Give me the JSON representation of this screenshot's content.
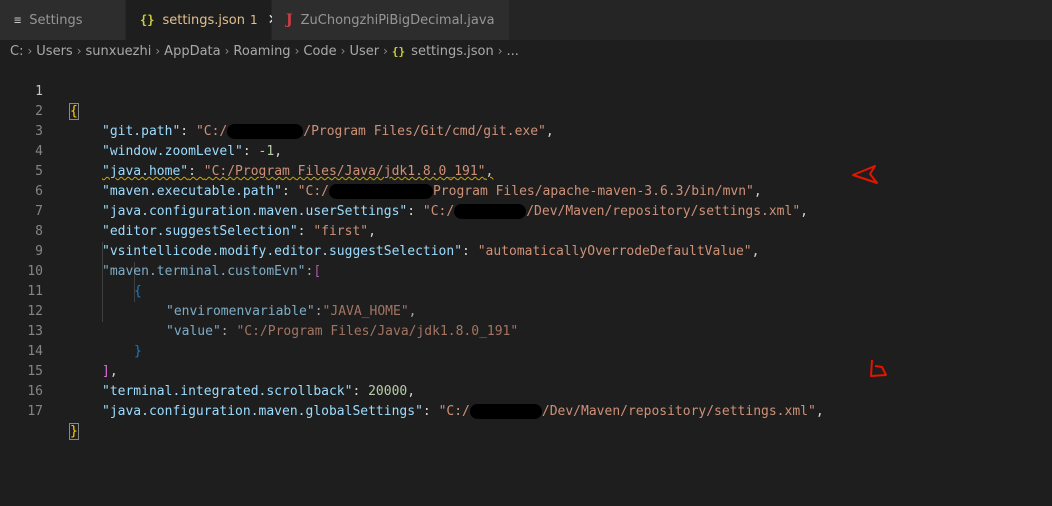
{
  "tabs": [
    {
      "label": "Settings",
      "icon": "menu-icon"
    },
    {
      "label": "settings.json",
      "badge": "1",
      "icon": "json-braces-icon",
      "active": true
    },
    {
      "label": "ZuChongzhiPiBigDecimal.java",
      "icon": "java-file-icon"
    }
  ],
  "breadcrumb": [
    "C:",
    "Users",
    "sunxuezhi",
    "AppData",
    "Roaming",
    "Code",
    "User",
    "settings.json",
    "..."
  ],
  "editor": {
    "line_numbers": [
      "1",
      "2",
      "3",
      "4",
      "5",
      "6",
      "7",
      "8",
      "9",
      "10",
      "11",
      "12",
      "13",
      "14",
      "15",
      "16",
      "17"
    ],
    "lines": {
      "l1_open": "{",
      "l2": {
        "key": "\"git.path\"",
        "colon": ": ",
        "val_a": "\"C:/",
        "val_b": "/Program Files/Git/cmd/git.exe\"",
        "comma": ","
      },
      "l3": {
        "key": "\"window.zoomLevel\"",
        "colon": ": ",
        "val": "-1",
        "comma": ","
      },
      "l4": {
        "key": "\"java.home\"",
        "colon": ": ",
        "val": "\"C:/Program Files/Java/jdk1.8.0_191\"",
        "comma": ","
      },
      "l5": {
        "key": "\"maven.executable.path\"",
        "colon": ": ",
        "val_a": "\"C:/",
        "val_b": "Program Files/apache-maven-3.6.3/bin/mvn\"",
        "comma": ","
      },
      "l6": {
        "key": "\"java.configuration.maven.userSettings\"",
        "colon": ": ",
        "val_a": "\"C:/",
        "val_b": "/Dev/Maven/repository/settings.xml\"",
        "comma": ","
      },
      "l7": {
        "key": "\"editor.suggestSelection\"",
        "colon": ": ",
        "val": "\"first\"",
        "comma": ","
      },
      "l8": {
        "key": "\"vsintellicode.modify.editor.suggestSelection\"",
        "colon": ": ",
        "val": "\"automaticallyOverrodeDefaultValue\"",
        "comma": ","
      },
      "l9": {
        "key": "\"maven.terminal.customEvn\"",
        "colon": ":",
        "bracket": "["
      },
      "l10": "{",
      "l11": {
        "key": "\"enviromenvariable\"",
        "colon": ":",
        "val": "\"JAVA_HOME\"",
        "comma": ","
      },
      "l12": {
        "key": "\"value\"",
        "colon": ": ",
        "val": "\"C:/Program Files/Java/jdk1.8.0_191\""
      },
      "l13": "}",
      "l14": {
        "bracket": "]",
        "comma": ","
      },
      "l15": {
        "key": "\"terminal.integrated.scrollback\"",
        "colon": ": ",
        "val": "20000",
        "comma": ","
      },
      "l16": {
        "key": "\"java.configuration.maven.globalSettings\"",
        "colon": ": ",
        "val_a": "\"C:/",
        "val_b": "/Dev/Maven/repository/settings.xml\"",
        "comma": ","
      },
      "l17_close": "}"
    }
  },
  "colors": {
    "key": "#9cdcfe",
    "string": "#ce9178",
    "number": "#b5cea8",
    "bracket_gold": "#ffd700",
    "bracket_purple": "#da70d6",
    "bracket_blue": "#179fff",
    "annotation": "#e51400"
  }
}
